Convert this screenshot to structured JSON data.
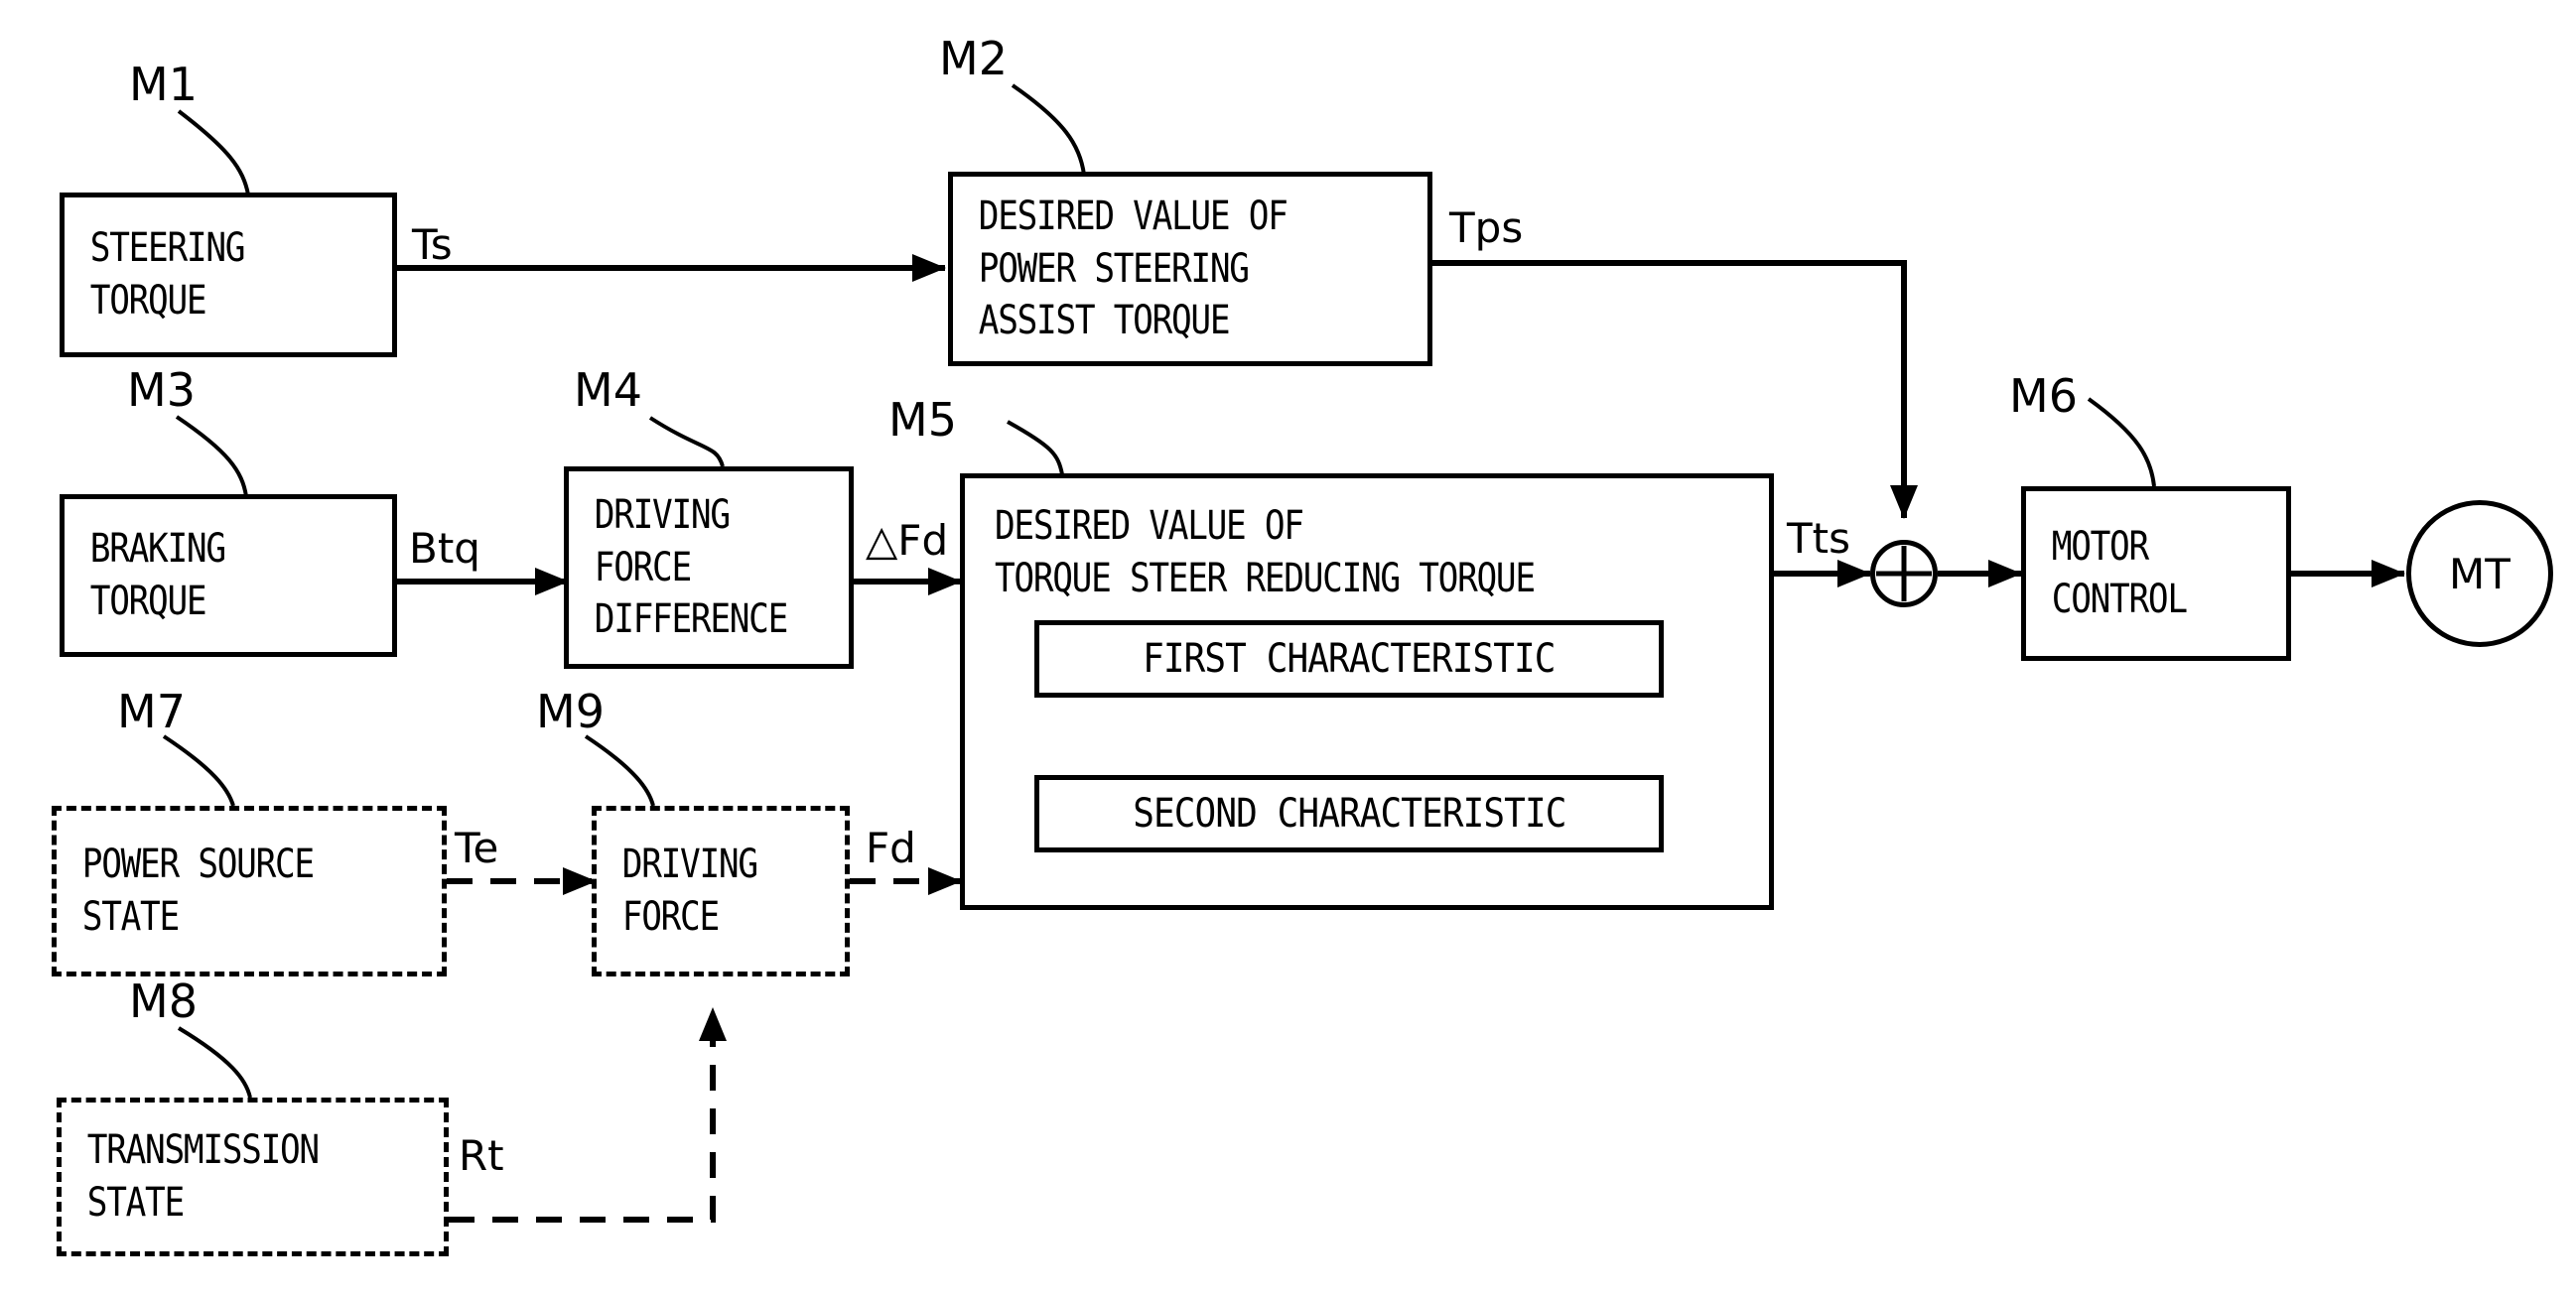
{
  "figure": {
    "type": "block-diagram",
    "description": "Torque steer reducing control block diagram"
  },
  "blocks": {
    "m1": {
      "ref": "M1",
      "lines": [
        "STEERING",
        "TORQUE"
      ]
    },
    "m2": {
      "ref": "M2",
      "lines": [
        "DESIRED VALUE OF",
        "POWER STEERING",
        "ASSIST TORQUE"
      ]
    },
    "m3": {
      "ref": "M3",
      "lines": [
        "BRAKING",
        "TORQUE"
      ]
    },
    "m4": {
      "ref": "M4",
      "lines": [
        "DRIVING",
        "FORCE",
        "DIFFERENCE"
      ]
    },
    "m5": {
      "ref": "M5",
      "lines": [
        "DESIRED VALUE OF",
        "TORQUE STEER REDUCING TORQUE"
      ],
      "inner": [
        {
          "label": "FIRST CHARACTERISTIC"
        },
        {
          "label": "SECOND CHARACTERISTIC"
        }
      ]
    },
    "m6": {
      "ref": "M6",
      "lines": [
        "MOTOR",
        "CONTROL"
      ]
    },
    "m7": {
      "ref": "M7",
      "lines": [
        "POWER SOURCE",
        "STATE"
      ]
    },
    "m8": {
      "ref": "M8",
      "lines": [
        "TRANSMISSION",
        "STATE"
      ]
    },
    "m9": {
      "ref": "M9",
      "lines": [
        "DRIVING",
        "FORCE"
      ]
    },
    "mt": {
      "label": "MT"
    },
    "sum": {
      "label": "+"
    }
  },
  "signals": {
    "ts": "Ts",
    "tps": "Tps",
    "btq": "Btq",
    "dfd": "△Fd",
    "tts": "Tts",
    "te": "Te",
    "fd": "Fd",
    "rt": "Rt"
  },
  "colors": {
    "stroke": "#000000",
    "background": "#ffffff"
  }
}
